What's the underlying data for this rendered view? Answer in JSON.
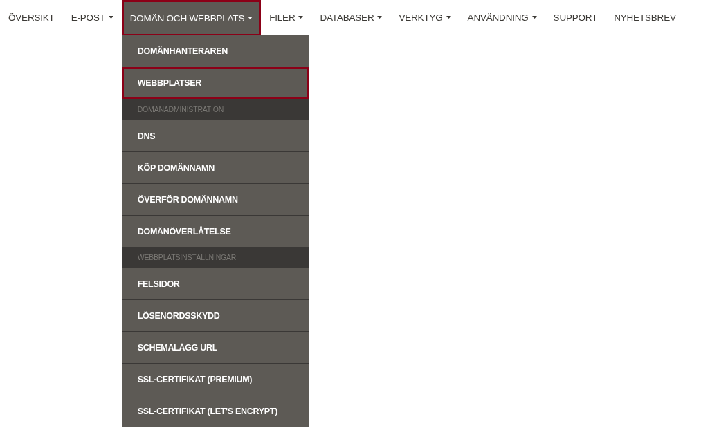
{
  "nav": [
    {
      "label": "ÖVERSIKT",
      "has_dropdown": false,
      "selected": false
    },
    {
      "label": "E-POST",
      "has_dropdown": true,
      "selected": false
    },
    {
      "label": "DOMÄN OCH WEBBPLATS",
      "has_dropdown": true,
      "selected": true
    },
    {
      "label": "FILER",
      "has_dropdown": true,
      "selected": false
    },
    {
      "label": "DATABASER",
      "has_dropdown": true,
      "selected": false
    },
    {
      "label": "VERKTYG",
      "has_dropdown": true,
      "selected": false
    },
    {
      "label": "ANVÄNDNING",
      "has_dropdown": true,
      "selected": false
    },
    {
      "label": "SUPPORT",
      "has_dropdown": false,
      "selected": false
    },
    {
      "label": "NYHETSBREV",
      "has_dropdown": false,
      "selected": false
    }
  ],
  "dropdown": {
    "items": [
      {
        "kind": "link",
        "label": "DOMÄNHANTERAREN",
        "selected": false
      },
      {
        "kind": "link",
        "label": "WEBBPLATSER",
        "selected": true
      },
      {
        "kind": "header",
        "label": "DOMÄNADMINISTRATION"
      },
      {
        "kind": "link",
        "label": "DNS",
        "selected": false
      },
      {
        "kind": "link",
        "label": "KÖP DOMÄNNAMN",
        "selected": false
      },
      {
        "kind": "link",
        "label": "ÖVERFÖR DOMÄNNAMN",
        "selected": false
      },
      {
        "kind": "link",
        "label": "DOMÄNÖVERLÅTELSE",
        "selected": false
      },
      {
        "kind": "header",
        "label": "WEBBPLATSINSTÄLLNINGAR"
      },
      {
        "kind": "link",
        "label": "FELSIDOR",
        "selected": false
      },
      {
        "kind": "link",
        "label": "LÖSENORDSSKYDD",
        "selected": false
      },
      {
        "kind": "link",
        "label": "SCHEMALÄGG URL",
        "selected": false
      },
      {
        "kind": "link",
        "label": "SSL-CERTIFIKAT (PREMIUM)",
        "selected": false
      },
      {
        "kind": "link",
        "label": "SSL-CERTIFIKAT (LET'S ENCRYPT)",
        "selected": false
      }
    ]
  }
}
